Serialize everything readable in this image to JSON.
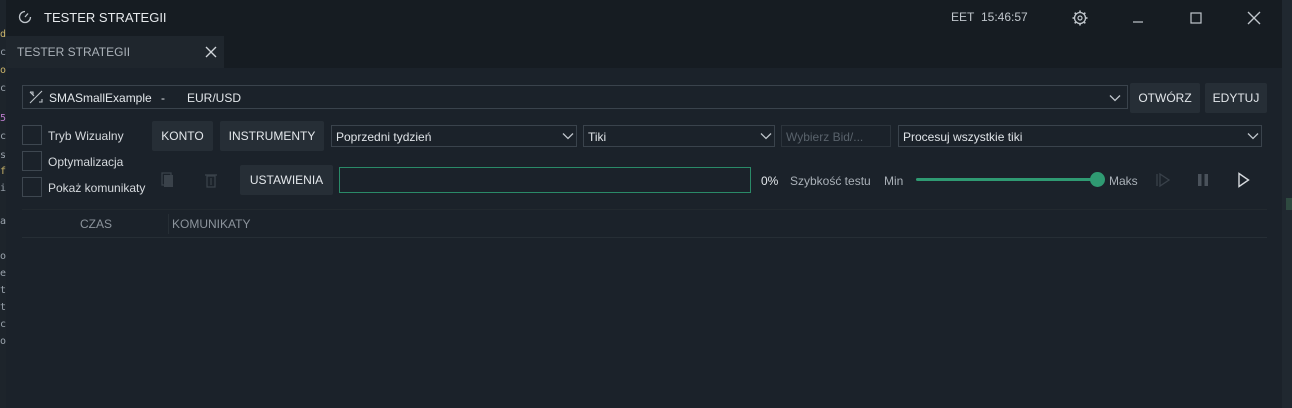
{
  "edge_chars": [
    "d",
    "c",
    "o",
    "c",
    "5",
    "c",
    "s",
    "f",
    "i",
    "a",
    "o",
    "e",
    "t",
    "t",
    "c",
    "o"
  ],
  "window": {
    "title": "TESTER STRATEGII",
    "timezone": "EET",
    "time": "15:46:57"
  },
  "tab": {
    "label": "TESTER STRATEGII"
  },
  "strategy": {
    "name": "SMASmallExample",
    "separator": "-",
    "pair": "EUR/USD",
    "open_label": "OTWÓRZ",
    "edit_label": "EDYTUJ"
  },
  "options": {
    "visual_mode": "Tryb Wizualny",
    "optimization": "Optymalizacja",
    "show_messages": "Pokaż komunikaty"
  },
  "toolbar": {
    "account": "KONTO",
    "instruments": "INSTRUMENTY",
    "period": "Poprzedni tydzień",
    "data_type": "Tiki",
    "bid_ask_placeholder": "Wybierz Bid/...",
    "tick_mode": "Procesuj wszystkie tiki",
    "settings": "USTAWIENIA"
  },
  "progress": {
    "value": 0,
    "text": "0%"
  },
  "speed": {
    "label": "Szybkość testu",
    "min": "Min",
    "max": "Maks",
    "level": 1.0
  },
  "log_table": {
    "columns": [
      "CZAS",
      "KOMUNIKATY"
    ]
  },
  "colors": {
    "accent": "#2f9a72",
    "background": "#1b222a",
    "titlebar": "#161c22"
  }
}
